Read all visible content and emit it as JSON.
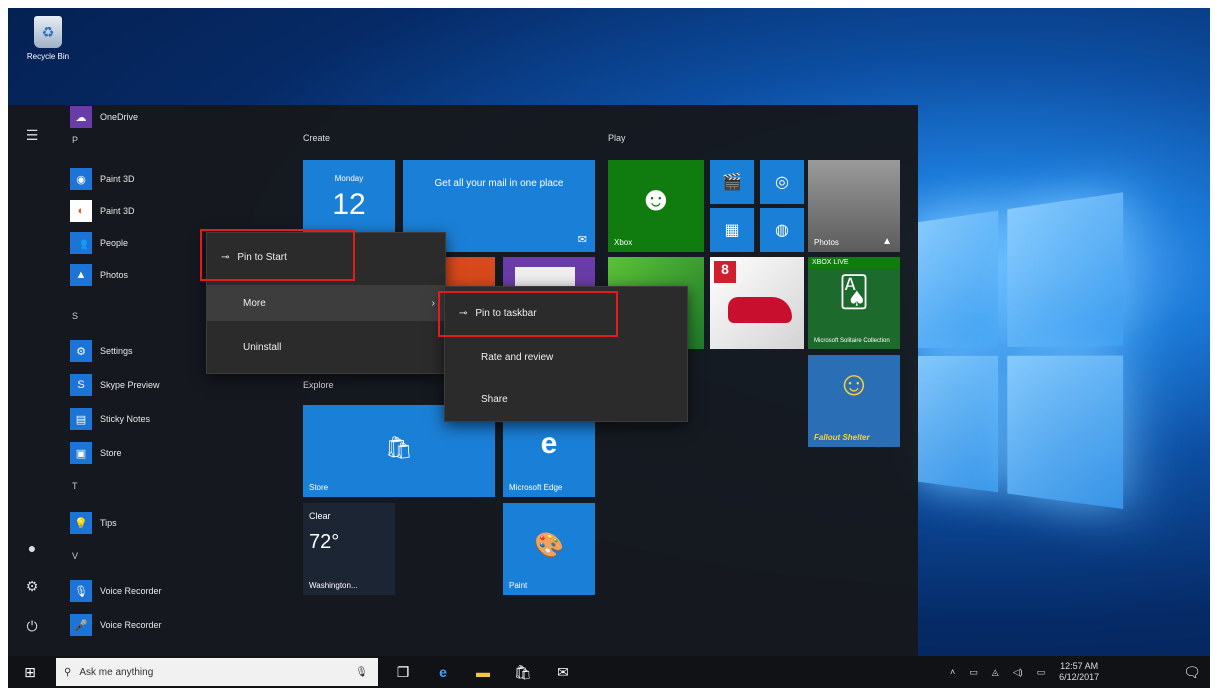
{
  "desktop": {
    "recycle_bin_label": "Recycle Bin"
  },
  "start_menu": {
    "apps": [
      {
        "label": "OneDrive",
        "icon": "onedrive-icon"
      },
      {
        "label": "Paint 3D",
        "icon": "paint-icon"
      },
      {
        "label": "People",
        "icon": "people-icon"
      },
      {
        "label": "Photos",
        "icon": "photos-icon"
      },
      {
        "label": "Settings",
        "icon": "gear-icon"
      },
      {
        "label": "Skype Preview",
        "icon": "skype-icon"
      },
      {
        "label": "Sticky Notes",
        "icon": "note-icon"
      },
      {
        "label": "Store",
        "icon": "store-icon"
      },
      {
        "label": "Tips",
        "icon": "tips-icon"
      },
      {
        "label": "Voice Recorder",
        "icon": "mic-icon"
      }
    ],
    "letters": [
      "P",
      "S",
      "T",
      "V"
    ],
    "groups": {
      "create": "Create",
      "play": "Play",
      "explore": "Explore"
    },
    "tiles": {
      "calendar_day": "Monday",
      "calendar_date": "12",
      "mail_text": "Get all your mail in one place",
      "xbox_label": "Xbox",
      "photos_label": "Photos",
      "store_label": "Store",
      "edge_label": "Microsoft Edge",
      "weather_condition": "Clear",
      "weather_temp": "72°",
      "weather_city": "Washington...",
      "paint_label": "Paint",
      "solitaire_label": "Microsoft Solitaire Collection",
      "xbox_live_badge": "XBOX LIVE",
      "fallout_label": "Fallout Shelter"
    }
  },
  "context_menu": {
    "pin_to_start": "Pin to Start",
    "more": "More",
    "uninstall": "Uninstall"
  },
  "submenu": {
    "pin_to_taskbar": "Pin to taskbar",
    "rate_review": "Rate and review",
    "share": "Share"
  },
  "taskbar": {
    "search_placeholder": "Ask me anything",
    "time": "12:57 AM",
    "date": "6/12/2017"
  },
  "colors": {
    "tile_blue": "#1a7fd6",
    "highlight_red": "#e21b1b",
    "xbox_green": "#107c10"
  }
}
